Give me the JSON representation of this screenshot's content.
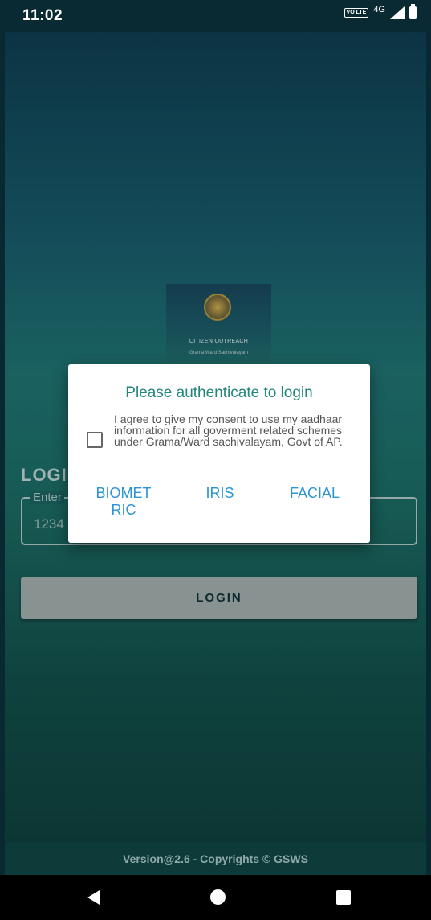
{
  "status_bar": {
    "time": "11:02",
    "volte_label": "VO LTE",
    "network_type": "4G",
    "icons": [
      "volte-icon",
      "signal-icon",
      "battery-icon"
    ]
  },
  "logo": {
    "title": "CITIZEN OUTREACH",
    "subtitle": "Grama Ward Sachivalayam"
  },
  "login_form": {
    "heading": "LOGI",
    "field_label": "Enter",
    "field_value": "1234",
    "login_button": "LOGIN"
  },
  "dialog": {
    "title": "Please authenticate to login",
    "consent_text": "I agree to give my consent to use my aadhaar information for all goverment related schemes under Grama/Ward sachivalayam, Govt of AP.",
    "consent_checked": false,
    "buttons": {
      "biometric": "BIOMET RIC",
      "iris": "IRIS",
      "facial": "FACIAL"
    }
  },
  "footer": {
    "text": "Version@2.6 - Copyrights © GSWS"
  },
  "nav_bar": {
    "icons": [
      "back-icon",
      "home-icon",
      "recents-icon"
    ]
  },
  "colors": {
    "dialog_title": "#22867c",
    "dialog_button": "#2b95d6",
    "login_button_bg": "#9aa7a6",
    "background_top": "#0e3b4d",
    "background_bottom": "#0e3e3b"
  }
}
